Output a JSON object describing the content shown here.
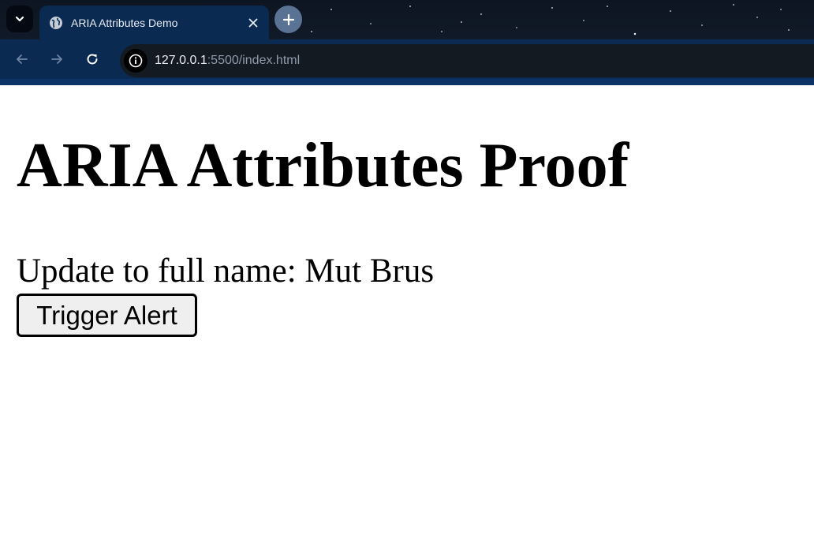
{
  "browser": {
    "tab": {
      "title": "ARIA Attributes Demo",
      "favicon": "globe-icon"
    },
    "icons": {
      "tab_search": "chevron-down-icon",
      "close_tab": "close-icon",
      "new_tab": "plus-icon",
      "back": "arrow-left-icon",
      "forward": "arrow-right-icon",
      "reload": "reload-icon",
      "site_info": "info-icon"
    },
    "address_bar": {
      "host": "127.0.0.1",
      "rest": ":5500/index.html"
    },
    "colors": {
      "frame": "#0b2a52",
      "omnibox": "#141a22",
      "new_tab_button": "#5a7294"
    }
  },
  "page": {
    "heading": "ARIA Attributes Proof",
    "status_text": "Update to full name: Mut Brus",
    "alert_button_label": "Trigger Alert"
  }
}
